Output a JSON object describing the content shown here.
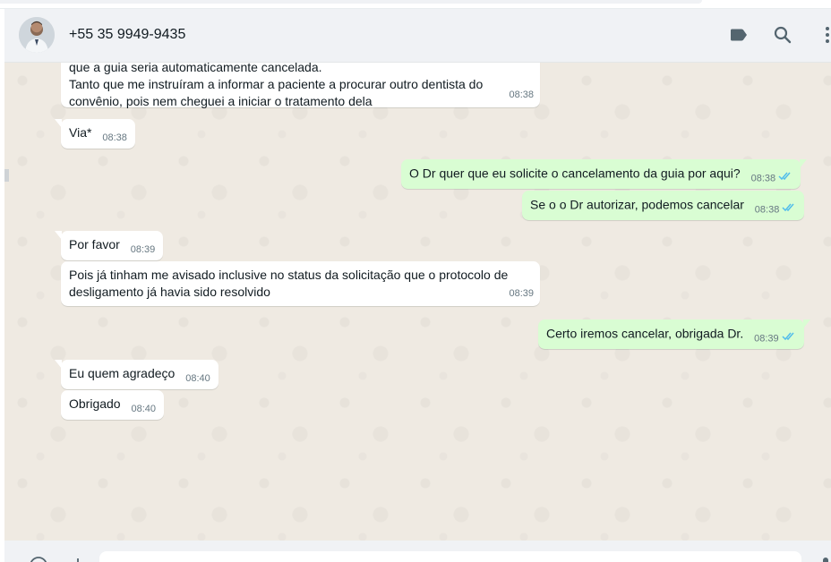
{
  "header": {
    "contact_name": "+55 35 9949-9435",
    "icons": [
      "label-icon",
      "search-icon",
      "menu-icon"
    ]
  },
  "messages": [
    {
      "direction": "in",
      "text": "que a guia seria automaticamente cancelada.\nTanto que me instruíram a informar a paciente a procurar outro dentista do\nconvênio, pois nem cheguei a iniciar o tratamento dela",
      "time": "08:38"
    },
    {
      "direction": "in",
      "text": "Via*",
      "time": "08:38"
    },
    {
      "direction": "out",
      "text": "O Dr quer que eu solicite o cancelamento da guia por aqui?",
      "time": "08:38",
      "status": "read"
    },
    {
      "direction": "out",
      "text": "Se o o Dr autorizar, podemos cancelar",
      "time": "08:38",
      "status": "read"
    },
    {
      "direction": "in",
      "text": "Por favor",
      "time": "08:39"
    },
    {
      "direction": "in",
      "text": "Pois já tinham me avisado inclusive no status da solicitação que o protocolo de\ndesligamento já havia sido resolvido",
      "time": "08:39"
    },
    {
      "direction": "out",
      "text": "Certo iremos cancelar, obrigada Dr.",
      "time": "08:39",
      "status": "read"
    },
    {
      "direction": "in",
      "text": "Eu quem agradeço",
      "time": "08:40"
    },
    {
      "direction": "in",
      "text": "Obrigado",
      "time": "08:40"
    }
  ],
  "colors": {
    "chat_background": "#efeae2",
    "outgoing_bubble": "#d9fdd3",
    "incoming_bubble": "#ffffff",
    "read_ticks": "#53bdeb",
    "header_background": "#f0f2f5"
  }
}
